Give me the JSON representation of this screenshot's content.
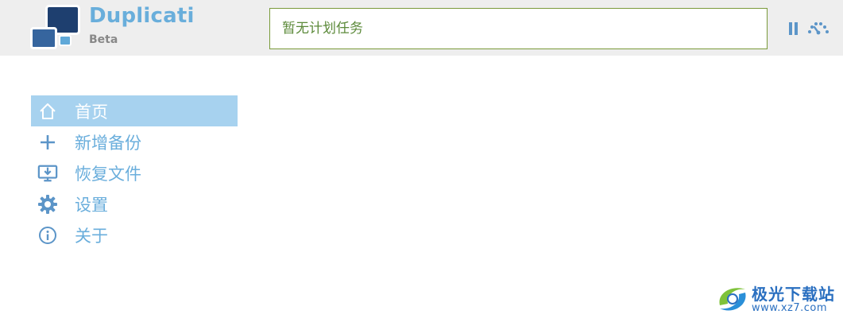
{
  "app": {
    "name": "Duplicati",
    "tag": "Beta"
  },
  "status": {
    "text": "暂无计划任务"
  },
  "controls": {
    "pause_icon": "pause-icon",
    "throttle_icon": "speed-gauge-icon"
  },
  "menu": {
    "items": [
      {
        "label": "首页",
        "icon": "home-icon",
        "active": true
      },
      {
        "label": "新增备份",
        "icon": "plus-icon",
        "active": false
      },
      {
        "label": "恢复文件",
        "icon": "restore-monitor-icon",
        "active": false
      },
      {
        "label": "设置",
        "icon": "gear-icon",
        "active": false
      },
      {
        "label": "关于",
        "icon": "info-icon",
        "active": false
      }
    ]
  },
  "watermark": {
    "title": "极光下载站",
    "url": "www.xz7.com"
  },
  "colors": {
    "header_bg": "#eeeeee",
    "accent": "#6aaedc",
    "active_bg": "#a7d2ef",
    "status_border": "#7a9a3a",
    "status_text": "#5c8a3a"
  }
}
